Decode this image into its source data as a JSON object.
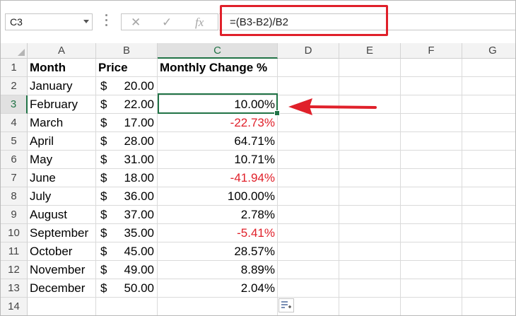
{
  "name_box": {
    "value": "C3"
  },
  "formula_bar": {
    "cancel_glyph": "✕",
    "enter_glyph": "✓",
    "fx_label": "fx",
    "formula": "=(B3-B2)/B2"
  },
  "columns": [
    "A",
    "B",
    "C",
    "D",
    "E",
    "F",
    "G"
  ],
  "selected_column": "C",
  "selected_row": "3",
  "row_numbers": [
    "1",
    "2",
    "3",
    "4",
    "5",
    "6",
    "7",
    "8",
    "9",
    "10",
    "11",
    "12",
    "13",
    "14"
  ],
  "headers": {
    "month": "Month",
    "price": "Price",
    "change": "Monthly Change %"
  },
  "rows": [
    {
      "month": "January",
      "price_symbol": "$",
      "price": "20.00",
      "change": ""
    },
    {
      "month": "February",
      "price_symbol": "$",
      "price": "22.00",
      "change": "10.00%"
    },
    {
      "month": "March",
      "price_symbol": "$",
      "price": "17.00",
      "change": "-22.73%"
    },
    {
      "month": "April",
      "price_symbol": "$",
      "price": "28.00",
      "change": "64.71%"
    },
    {
      "month": "May",
      "price_symbol": "$",
      "price": "31.00",
      "change": "10.71%"
    },
    {
      "month": "June",
      "price_symbol": "$",
      "price": "18.00",
      "change": "-41.94%"
    },
    {
      "month": "July",
      "price_symbol": "$",
      "price": "36.00",
      "change": "100.00%"
    },
    {
      "month": "August",
      "price_symbol": "$",
      "price": "37.00",
      "change": "2.78%"
    },
    {
      "month": "September",
      "price_symbol": "$",
      "price": "35.00",
      "change": "-5.41%"
    },
    {
      "month": "October",
      "price_symbol": "$",
      "price": "45.00",
      "change": "28.57%"
    },
    {
      "month": "November",
      "price_symbol": "$",
      "price": "49.00",
      "change": "8.89%"
    },
    {
      "month": "December",
      "price_symbol": "$",
      "price": "50.00",
      "change": "2.04%"
    }
  ],
  "colors": {
    "accent": "#217346",
    "negative": "#e0202a",
    "highlight": "#e0202a"
  },
  "icons": {
    "quick_analysis": "quick-analysis-icon",
    "annotation_arrow": "arrow-left-icon"
  }
}
